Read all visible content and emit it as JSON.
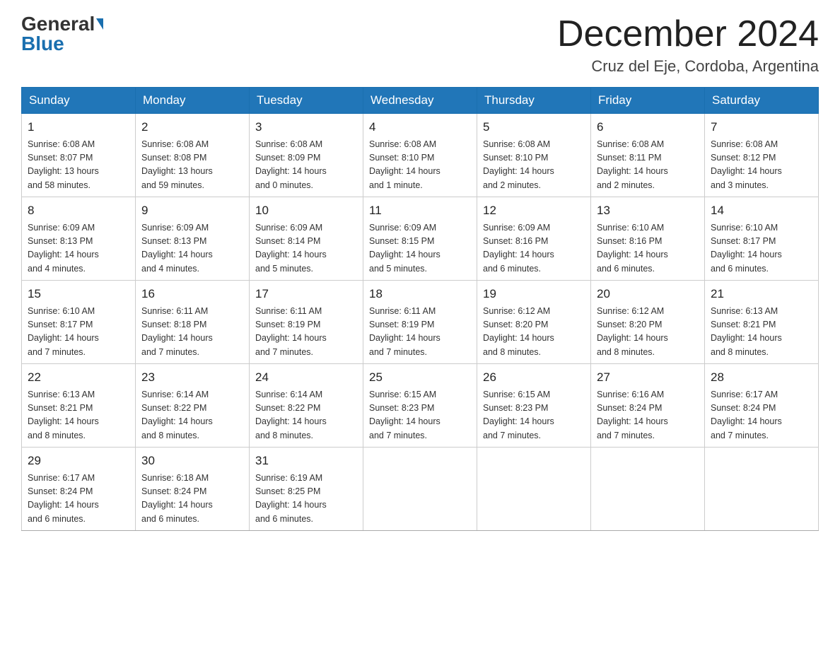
{
  "header": {
    "logo_general": "General",
    "logo_blue": "Blue",
    "month_title": "December 2024",
    "location": "Cruz del Eje, Cordoba, Argentina"
  },
  "days_of_week": [
    "Sunday",
    "Monday",
    "Tuesday",
    "Wednesday",
    "Thursday",
    "Friday",
    "Saturday"
  ],
  "weeks": [
    [
      {
        "day": "1",
        "sunrise": "6:08 AM",
        "sunset": "8:07 PM",
        "daylight": "13 hours and 58 minutes."
      },
      {
        "day": "2",
        "sunrise": "6:08 AM",
        "sunset": "8:08 PM",
        "daylight": "13 hours and 59 minutes."
      },
      {
        "day": "3",
        "sunrise": "6:08 AM",
        "sunset": "8:09 PM",
        "daylight": "14 hours and 0 minutes."
      },
      {
        "day": "4",
        "sunrise": "6:08 AM",
        "sunset": "8:10 PM",
        "daylight": "14 hours and 1 minute."
      },
      {
        "day": "5",
        "sunrise": "6:08 AM",
        "sunset": "8:10 PM",
        "daylight": "14 hours and 2 minutes."
      },
      {
        "day": "6",
        "sunrise": "6:08 AM",
        "sunset": "8:11 PM",
        "daylight": "14 hours and 2 minutes."
      },
      {
        "day": "7",
        "sunrise": "6:08 AM",
        "sunset": "8:12 PM",
        "daylight": "14 hours and 3 minutes."
      }
    ],
    [
      {
        "day": "8",
        "sunrise": "6:09 AM",
        "sunset": "8:13 PM",
        "daylight": "14 hours and 4 minutes."
      },
      {
        "day": "9",
        "sunrise": "6:09 AM",
        "sunset": "8:13 PM",
        "daylight": "14 hours and 4 minutes."
      },
      {
        "day": "10",
        "sunrise": "6:09 AM",
        "sunset": "8:14 PM",
        "daylight": "14 hours and 5 minutes."
      },
      {
        "day": "11",
        "sunrise": "6:09 AM",
        "sunset": "8:15 PM",
        "daylight": "14 hours and 5 minutes."
      },
      {
        "day": "12",
        "sunrise": "6:09 AM",
        "sunset": "8:16 PM",
        "daylight": "14 hours and 6 minutes."
      },
      {
        "day": "13",
        "sunrise": "6:10 AM",
        "sunset": "8:16 PM",
        "daylight": "14 hours and 6 minutes."
      },
      {
        "day": "14",
        "sunrise": "6:10 AM",
        "sunset": "8:17 PM",
        "daylight": "14 hours and 6 minutes."
      }
    ],
    [
      {
        "day": "15",
        "sunrise": "6:10 AM",
        "sunset": "8:17 PM",
        "daylight": "14 hours and 7 minutes."
      },
      {
        "day": "16",
        "sunrise": "6:11 AM",
        "sunset": "8:18 PM",
        "daylight": "14 hours and 7 minutes."
      },
      {
        "day": "17",
        "sunrise": "6:11 AM",
        "sunset": "8:19 PM",
        "daylight": "14 hours and 7 minutes."
      },
      {
        "day": "18",
        "sunrise": "6:11 AM",
        "sunset": "8:19 PM",
        "daylight": "14 hours and 7 minutes."
      },
      {
        "day": "19",
        "sunrise": "6:12 AM",
        "sunset": "8:20 PM",
        "daylight": "14 hours and 8 minutes."
      },
      {
        "day": "20",
        "sunrise": "6:12 AM",
        "sunset": "8:20 PM",
        "daylight": "14 hours and 8 minutes."
      },
      {
        "day": "21",
        "sunrise": "6:13 AM",
        "sunset": "8:21 PM",
        "daylight": "14 hours and 8 minutes."
      }
    ],
    [
      {
        "day": "22",
        "sunrise": "6:13 AM",
        "sunset": "8:21 PM",
        "daylight": "14 hours and 8 minutes."
      },
      {
        "day": "23",
        "sunrise": "6:14 AM",
        "sunset": "8:22 PM",
        "daylight": "14 hours and 8 minutes."
      },
      {
        "day": "24",
        "sunrise": "6:14 AM",
        "sunset": "8:22 PM",
        "daylight": "14 hours and 8 minutes."
      },
      {
        "day": "25",
        "sunrise": "6:15 AM",
        "sunset": "8:23 PM",
        "daylight": "14 hours and 7 minutes."
      },
      {
        "day": "26",
        "sunrise": "6:15 AM",
        "sunset": "8:23 PM",
        "daylight": "14 hours and 7 minutes."
      },
      {
        "day": "27",
        "sunrise": "6:16 AM",
        "sunset": "8:24 PM",
        "daylight": "14 hours and 7 minutes."
      },
      {
        "day": "28",
        "sunrise": "6:17 AM",
        "sunset": "8:24 PM",
        "daylight": "14 hours and 7 minutes."
      }
    ],
    [
      {
        "day": "29",
        "sunrise": "6:17 AM",
        "sunset": "8:24 PM",
        "daylight": "14 hours and 6 minutes."
      },
      {
        "day": "30",
        "sunrise": "6:18 AM",
        "sunset": "8:24 PM",
        "daylight": "14 hours and 6 minutes."
      },
      {
        "day": "31",
        "sunrise": "6:19 AM",
        "sunset": "8:25 PM",
        "daylight": "14 hours and 6 minutes."
      },
      null,
      null,
      null,
      null
    ]
  ],
  "labels": {
    "sunrise": "Sunrise:",
    "sunset": "Sunset:",
    "daylight": "Daylight:"
  }
}
